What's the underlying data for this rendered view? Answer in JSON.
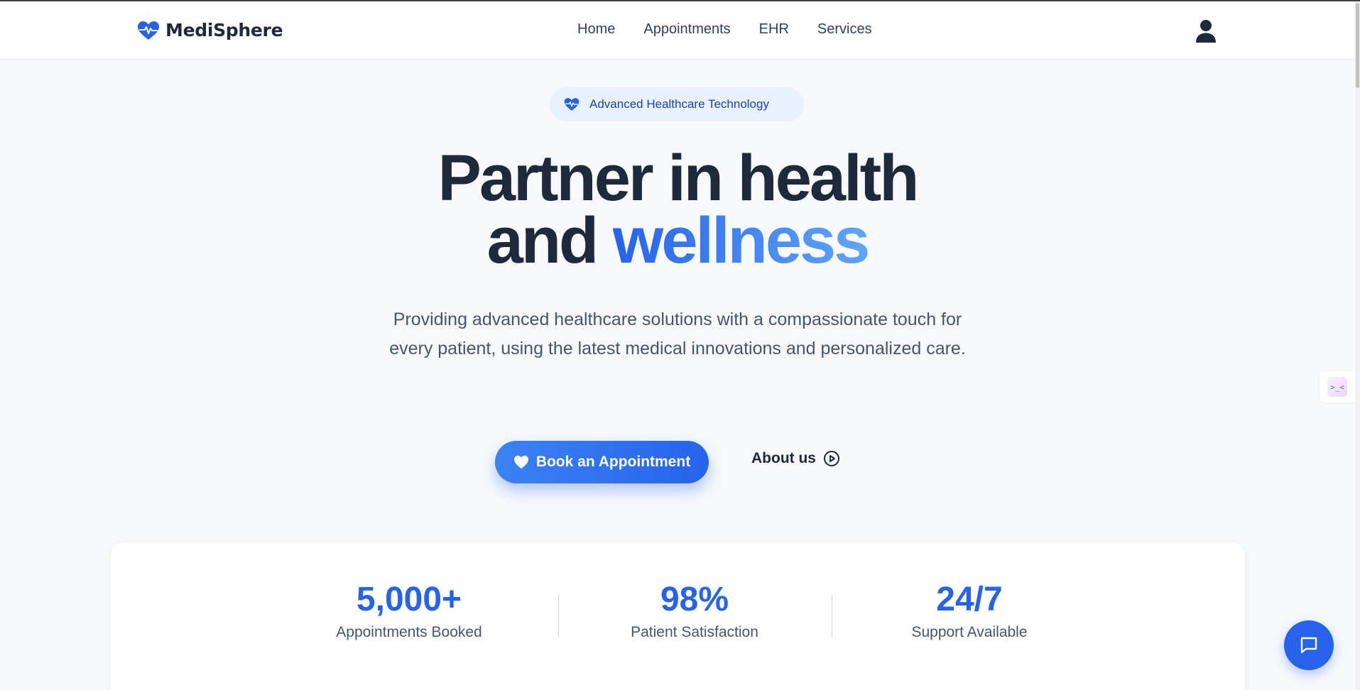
{
  "header": {
    "brand": "MediSphere",
    "nav": [
      {
        "label": "Home"
      },
      {
        "label": "Appointments"
      },
      {
        "label": "EHR"
      },
      {
        "label": "Services"
      }
    ],
    "user_icon": "user-icon"
  },
  "hero": {
    "badge": "Advanced Healthcare Technology",
    "headline_line1": "Partner in health",
    "headline_line2_plain": "and",
    "headline_line2_accent": "wellness",
    "subtitle": "Providing advanced healthcare solutions with a compassionate touch for every patient, using the latest medical innovations and personalized care.",
    "cta_label": "Book an Appointment",
    "about_label": "About us"
  },
  "stats": [
    {
      "value": "5,000+",
      "label": "Appointments Booked"
    },
    {
      "value": "98%",
      "label": "Patient Satisfaction"
    },
    {
      "value": "24/7",
      "label": "Support Available"
    }
  ],
  "side_widget_text": ">_<",
  "colors": {
    "primary": "#2563eb",
    "accent_light": "#60a5fa",
    "text_dark": "#1e293b",
    "text_muted": "#475569",
    "background": "#f7f9fc",
    "badge_bg": "#eaf1fe"
  }
}
